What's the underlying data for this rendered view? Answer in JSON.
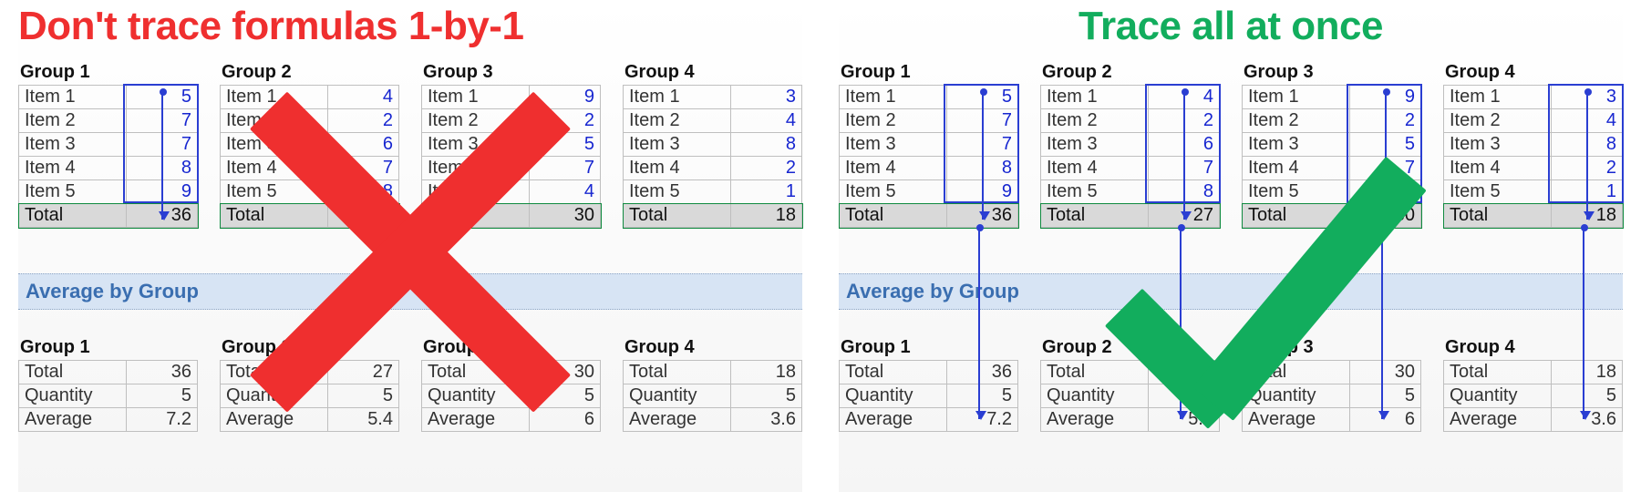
{
  "left_heading": "Don't trace formulas 1-by-1",
  "right_heading": "Trace all at once",
  "avg_band_label": "Average by Group",
  "groups": [
    {
      "title": "Group 1",
      "items": [
        {
          "label": "Item 1",
          "value": 5
        },
        {
          "label": "Item 2",
          "value": 7
        },
        {
          "label": "Item 3",
          "value": 7
        },
        {
          "label": "Item 4",
          "value": 8
        },
        {
          "label": "Item 5",
          "value": 9
        }
      ],
      "total_label": "Total",
      "total_value": 36,
      "summary": {
        "total_label": "Total",
        "total": 36,
        "qty_label": "Quantity",
        "qty": 5,
        "avg_label": "Average",
        "avg": 7.2
      }
    },
    {
      "title": "Group 2",
      "items": [
        {
          "label": "Item 1",
          "value": 4
        },
        {
          "label": "Item 2",
          "value": 2
        },
        {
          "label": "Item 3",
          "value": 6
        },
        {
          "label": "Item 4",
          "value": 7
        },
        {
          "label": "Item 5",
          "value": 8
        }
      ],
      "total_label": "Total",
      "total_value": 27,
      "summary": {
        "total_label": "Total",
        "total": 27,
        "qty_label": "Quantity",
        "qty": 5,
        "avg_label": "Average",
        "avg": 5.4
      }
    },
    {
      "title": "Group 3",
      "items": [
        {
          "label": "Item 1",
          "value": 9
        },
        {
          "label": "Item 2",
          "value": 2
        },
        {
          "label": "Item 3",
          "value": 5
        },
        {
          "label": "Item 4",
          "value": 7
        },
        {
          "label": "Item 5",
          "value": 4
        }
      ],
      "total_label": "Total",
      "total_value": 30,
      "summary": {
        "total_label": "Total",
        "total": 30,
        "qty_label": "Quantity",
        "qty": 5,
        "avg_label": "Average",
        "avg": 6
      }
    },
    {
      "title": "Group 4",
      "items": [
        {
          "label": "Item 1",
          "value": 3
        },
        {
          "label": "Item 2",
          "value": 4
        },
        {
          "label": "Item 3",
          "value": 8
        },
        {
          "label": "Item 4",
          "value": 2
        },
        {
          "label": "Item 5",
          "value": 1
        }
      ],
      "total_label": "Total",
      "total_value": 18,
      "summary": {
        "total_label": "Total",
        "total": 18,
        "qty_label": "Quantity",
        "qty": 5,
        "avg_label": "Average",
        "avg": 3.6
      }
    }
  ],
  "left_traces": {
    "short_arrow_groups": [
      0
    ],
    "long_arrow_groups": []
  },
  "right_traces": {
    "short_arrow_groups": [
      0,
      1,
      2,
      3
    ],
    "long_arrow_groups": [
      0,
      1,
      2,
      3
    ]
  }
}
